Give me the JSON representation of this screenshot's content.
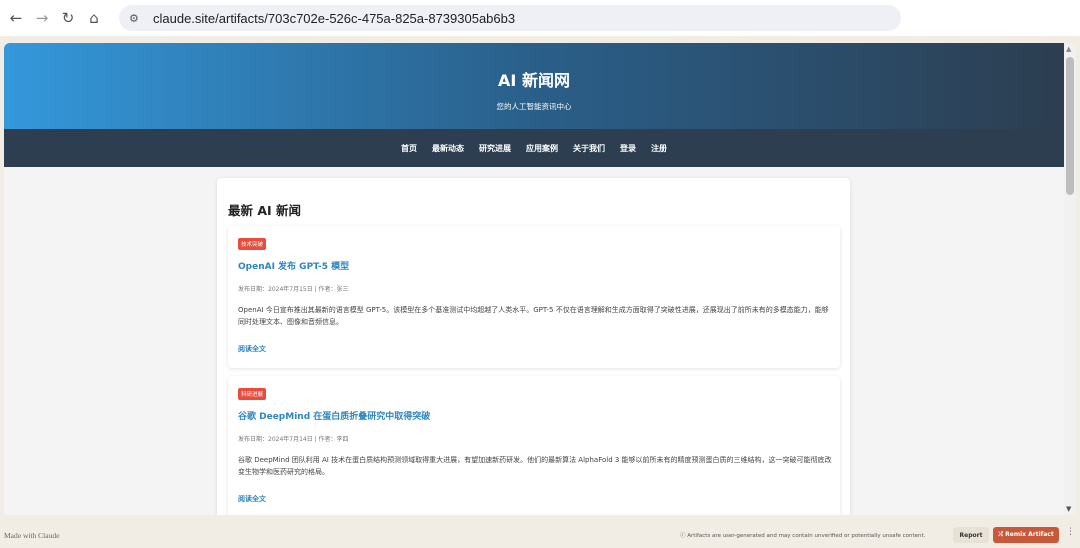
{
  "browser": {
    "back_icon": "←",
    "forward_icon": "→",
    "reload_icon": "↻",
    "home_icon": "⌂",
    "site_info_icon": "⚙",
    "url": "claude.site/artifacts/703c702e-526c-475a-825a-8739305ab6b3"
  },
  "site": {
    "title": "AI 新闻网",
    "subtitle": "您的人工智能资讯中心",
    "nav": [
      "首页",
      "最新动态",
      "研究进展",
      "应用案例",
      "关于我们",
      "登录",
      "注册"
    ]
  },
  "main": {
    "section_title": "最新 AI 新闻",
    "articles": [
      {
        "tag": "技术突破",
        "title": "OpenAI 发布 GPT-5 模型",
        "meta": "发布日期：2024年7月15日 | 作者：张三",
        "body": "OpenAI 今日宣布推出其最新的语言模型 GPT-5。该模型在多个基准测试中均超越了人类水平。GPT-5 不仅在语言理解和生成方面取得了突破性进展，还展现出了前所未有的多模态能力，能够同时处理文本、图像和音频信息。",
        "read_more": "阅读全文"
      },
      {
        "tag": "科研进展",
        "title": "谷歌 DeepMind 在蛋白质折叠研究中取得突破",
        "meta": "发布日期：2024年7月14日 | 作者：李四",
        "body": "谷歌 DeepMind 团队利用 AI 技术在蛋白质结构预测领域取得重大进展，有望加速新药研发。他们的最新算法 AlphaFold 3 能够以前所未有的精度预测蛋白质的三维结构，这一突破可能彻底改变生物学和医药研究的格局。",
        "read_more": "阅读全文"
      }
    ]
  },
  "footer": {
    "made_with": "Made with Claude",
    "disclaimer": "ⓘ Artifacts are user-generated and may contain unverified or potentially unsafe content.",
    "report": "Report",
    "remix": "⤮ Remix Artifact",
    "more": "⋮"
  },
  "colors": {
    "accent_blue": "#3498db",
    "nav_dark": "#2c3e50",
    "tag_red": "#e74c3c",
    "link_blue": "#2e86c1",
    "remix_orange": "#c7583a"
  }
}
